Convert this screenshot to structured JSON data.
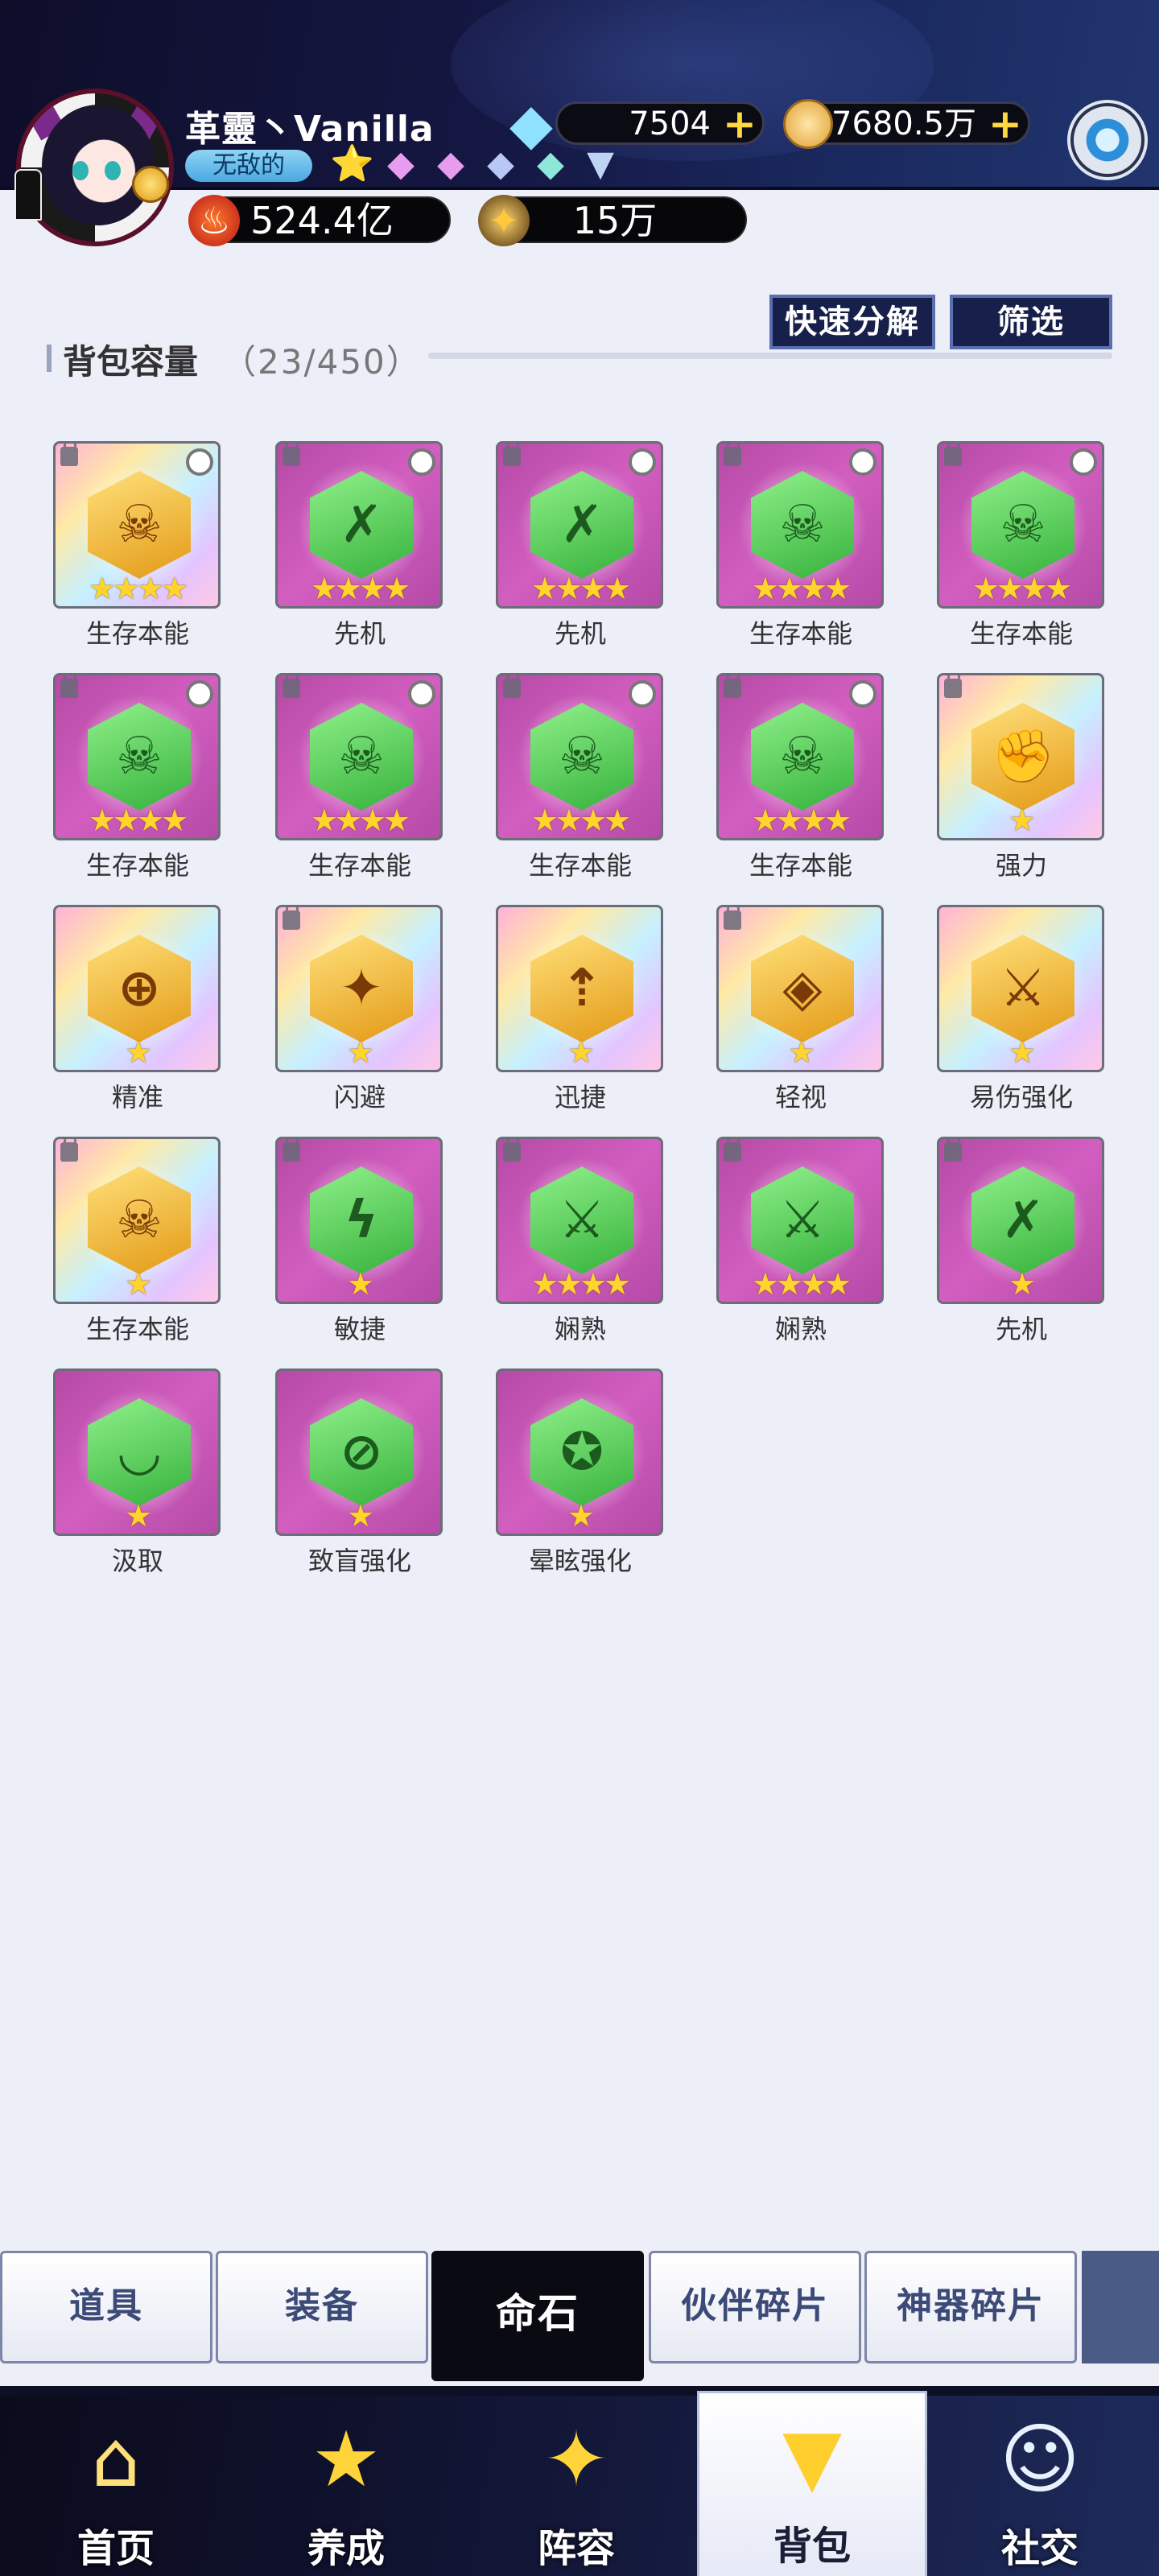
{
  "player": {
    "name": "革靈丶Vanilla",
    "title": "无敌的",
    "gems": [
      {
        "icon": "star-gem-gold",
        "char": "⭐",
        "color": "#f3c233"
      },
      {
        "icon": "diamond-pink",
        "char": "◆",
        "color": "#e89cf0"
      },
      {
        "icon": "diamond-pink",
        "char": "◆",
        "color": "#e89cf0"
      },
      {
        "icon": "diamond-blue",
        "char": "◆",
        "color": "#b7c8f5"
      },
      {
        "icon": "diamond-teal",
        "char": "◆",
        "color": "#8de8d9"
      },
      {
        "icon": "heart-diamond",
        "char": "▼",
        "color": "#bfd3f5"
      }
    ]
  },
  "currencies": {
    "diamond": "7504",
    "gold": "7680.5万"
  },
  "stats": {
    "power": "524.4亿",
    "other": "15万"
  },
  "capacity": {
    "title": "背包容量",
    "count": "（23/450）"
  },
  "buttons": {
    "decompose": "快速分解",
    "filter": "筛选"
  },
  "items": [
    {
      "name": "生存本能",
      "stars": 4,
      "bg": "rainbow",
      "hex": "gold",
      "sym": "☠",
      "lock": true,
      "radio": true
    },
    {
      "name": "先机",
      "stars": 4,
      "bg": "pink",
      "hex": "green",
      "sym": "✗",
      "lock": true,
      "radio": true
    },
    {
      "name": "先机",
      "stars": 4,
      "bg": "pink",
      "hex": "green",
      "sym": "✗",
      "lock": true,
      "radio": true
    },
    {
      "name": "生存本能",
      "stars": 4,
      "bg": "pink",
      "hex": "green",
      "sym": "☠",
      "lock": true,
      "radio": true
    },
    {
      "name": "生存本能",
      "stars": 4,
      "bg": "pink",
      "hex": "green",
      "sym": "☠",
      "lock": true,
      "radio": true
    },
    {
      "name": "生存本能",
      "stars": 4,
      "bg": "pink",
      "hex": "green",
      "sym": "☠",
      "lock": true,
      "radio": true
    },
    {
      "name": "生存本能",
      "stars": 4,
      "bg": "pink",
      "hex": "green",
      "sym": "☠",
      "lock": true,
      "radio": true
    },
    {
      "name": "生存本能",
      "stars": 4,
      "bg": "pink",
      "hex": "green",
      "sym": "☠",
      "lock": true,
      "radio": true
    },
    {
      "name": "生存本能",
      "stars": 4,
      "bg": "pink",
      "hex": "green",
      "sym": "☠",
      "lock": true,
      "radio": true
    },
    {
      "name": "强力",
      "stars": 1,
      "bg": "rainbow",
      "hex": "gold",
      "sym": "✊",
      "lock": true,
      "radio": false
    },
    {
      "name": "精准",
      "stars": 1,
      "bg": "rainbow",
      "hex": "gold",
      "sym": "⊕",
      "lock": false,
      "radio": false
    },
    {
      "name": "闪避",
      "stars": 1,
      "bg": "rainbow",
      "hex": "gold",
      "sym": "✦",
      "lock": true,
      "radio": false
    },
    {
      "name": "迅捷",
      "stars": 1,
      "bg": "rainbow",
      "hex": "gold",
      "sym": "⇡",
      "lock": false,
      "radio": false
    },
    {
      "name": "轻视",
      "stars": 1,
      "bg": "rainbow",
      "hex": "gold",
      "sym": "◈",
      "lock": true,
      "radio": false
    },
    {
      "name": "易伤强化",
      "stars": 1,
      "bg": "rainbow",
      "hex": "gold",
      "sym": "⚔",
      "lock": false,
      "radio": false
    },
    {
      "name": "生存本能",
      "stars": 1,
      "bg": "rainbow",
      "hex": "gold",
      "sym": "☠",
      "lock": true,
      "radio": false
    },
    {
      "name": "敏捷",
      "stars": 1,
      "bg": "pink",
      "hex": "green",
      "sym": "ϟ",
      "lock": true,
      "radio": false
    },
    {
      "name": "娴熟",
      "stars": 4,
      "bg": "pink",
      "hex": "green",
      "sym": "⚔",
      "lock": true,
      "radio": false
    },
    {
      "name": "娴熟",
      "stars": 4,
      "bg": "pink",
      "hex": "green",
      "sym": "⚔",
      "lock": true,
      "radio": false
    },
    {
      "name": "先机",
      "stars": 1,
      "bg": "pink",
      "hex": "green",
      "sym": "✗",
      "lock": true,
      "radio": false
    },
    {
      "name": "汲取",
      "stars": 1,
      "bg": "pink",
      "hex": "green",
      "sym": "◡",
      "lock": false,
      "radio": false
    },
    {
      "name": "致盲强化",
      "stars": 1,
      "bg": "pink",
      "hex": "green",
      "sym": "⊘",
      "lock": false,
      "radio": false
    },
    {
      "name": "晕眩强化",
      "stars": 1,
      "bg": "pink",
      "hex": "green",
      "sym": "✪",
      "lock": false,
      "radio": false
    }
  ],
  "tabs": [
    {
      "label": "道具",
      "active": false
    },
    {
      "label": "装备",
      "active": false
    },
    {
      "label": "命石",
      "active": true
    },
    {
      "label": "伙伴碎片",
      "active": false
    },
    {
      "label": "神器碎片",
      "active": false
    }
  ],
  "nav": [
    {
      "label": "首页",
      "icon": "home-icon",
      "char": "⌂",
      "color": "#ffe07a",
      "active": false
    },
    {
      "label": "养成",
      "icon": "star-up-icon",
      "char": "★",
      "color": "#ffd43a",
      "active": false
    },
    {
      "label": "阵容",
      "icon": "formation-icon",
      "char": "✦",
      "color": "#ffd43a",
      "active": false
    },
    {
      "label": "背包",
      "icon": "backpack-icon",
      "char": "▼",
      "color": "#ffcf2e",
      "active": true
    },
    {
      "label": "社交",
      "icon": "social-icon",
      "char": "☺",
      "color": "#e8f2ff",
      "active": false
    }
  ]
}
